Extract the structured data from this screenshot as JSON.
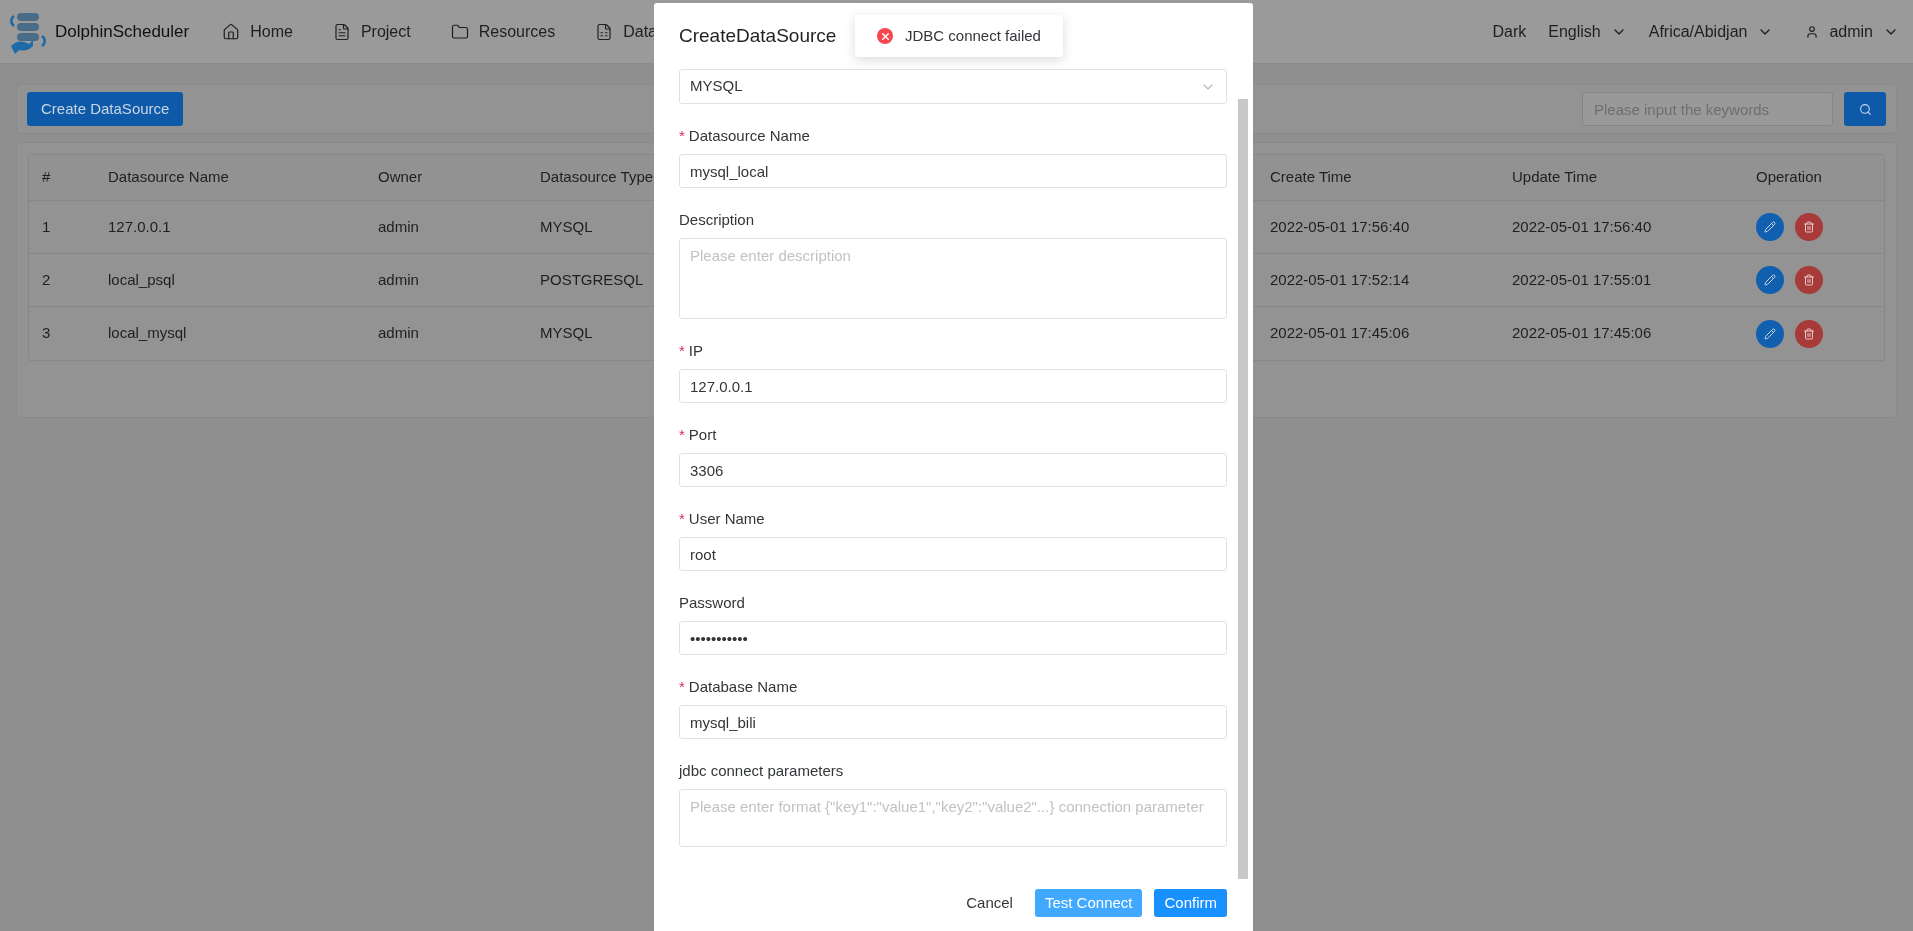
{
  "header": {
    "brand": "DolphinScheduler",
    "nav": [
      {
        "label": "Home"
      },
      {
        "label": "Project"
      },
      {
        "label": "Resources"
      },
      {
        "label": "Data"
      }
    ],
    "theme": "Dark",
    "language": "English",
    "timezone": "Africa/Abidjan",
    "user": "admin"
  },
  "toolbar": {
    "create_button": "Create DataSource",
    "search": {
      "placeholder": "Please input the keywords"
    }
  },
  "table": {
    "columns": [
      "#",
      "Datasource Name",
      "Owner",
      "Datasource Type",
      "",
      "Create Time",
      "Update Time",
      "Operation"
    ],
    "rows": [
      {
        "cells": [
          "1",
          "127.0.0.1",
          "admin",
          "MYSQL",
          "",
          "2022-05-01 17:56:40",
          "2022-05-01 17:56:40"
        ]
      },
      {
        "cells": [
          "2",
          "local_psql",
          "admin",
          "POSTGRESQL",
          "",
          "2022-05-01 17:52:14",
          "2022-05-01 17:55:01"
        ]
      },
      {
        "cells": [
          "3",
          "local_mysql",
          "admin",
          "MYSQL",
          "",
          "2022-05-01 17:45:06",
          "2022-05-01 17:45:06"
        ]
      }
    ]
  },
  "dialog": {
    "title": "CreateDataSource",
    "required_mark": "*",
    "fields": [
      {
        "kind": "select",
        "value": "MYSQL"
      },
      {
        "kind": "input",
        "label": "Datasource Name",
        "required": true,
        "value": "mysql_local"
      },
      {
        "kind": "textarea",
        "label": "Description",
        "required": false,
        "placeholder": "Please enter description"
      },
      {
        "kind": "input",
        "label": "IP",
        "required": true,
        "value": "127.0.0.1"
      },
      {
        "kind": "input",
        "label": "Port",
        "required": true,
        "value": "3306"
      },
      {
        "kind": "input",
        "label": "User Name",
        "required": true,
        "value": "root"
      },
      {
        "kind": "input",
        "label": "Password",
        "required": false,
        "value": "•••••••••••"
      },
      {
        "kind": "input",
        "label": "Database Name",
        "required": true,
        "value": "mysql_bili"
      },
      {
        "kind": "textarea",
        "label": "jdbc connect parameters",
        "required": false,
        "placeholder": "Please enter format {\"key1\":\"value1\",\"key2\":\"value2\"...} connection parameter"
      }
    ],
    "buttons": [
      {
        "kind": "text",
        "label": "Cancel"
      },
      {
        "kind": "secondary",
        "label": "Test Connect"
      },
      {
        "kind": "primary",
        "label": "Confirm"
      }
    ]
  },
  "toast": {
    "kind": "error",
    "message": "JDBC connect failed"
  }
}
